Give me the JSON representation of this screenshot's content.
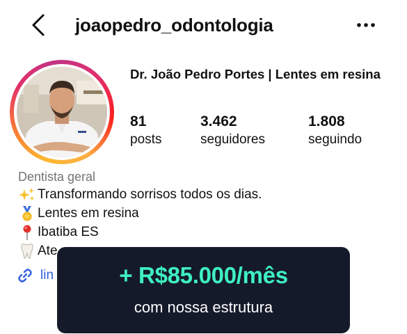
{
  "header": {
    "username": "joaopedro_odontologia",
    "back_icon": "chevron-left-icon",
    "more_icon": "more-horizontal-icon"
  },
  "profile": {
    "display_name": "Dr. João Pedro Portes | Lentes em resina",
    "stats": [
      {
        "value": "81",
        "label": "posts"
      },
      {
        "value": "3.462",
        "label": "seguidores"
      },
      {
        "value": "1.808",
        "label": "seguindo"
      }
    ],
    "category": "Dentista geral",
    "bio": [
      {
        "icon": "sparkles-icon",
        "text": "Transformando sorrisos todos os dias."
      },
      {
        "icon": "medal-icon",
        "text": "Lentes em resina"
      },
      {
        "icon": "pin-icon",
        "text": "Ibatiba ES"
      },
      {
        "icon": "tooth-icon",
        "text": "Ate"
      }
    ],
    "link_text": "lin"
  },
  "promo": {
    "amount": "+ R$85.000/mês",
    "subtitle": "com nossa estrutura"
  },
  "colors": {
    "promo_bg": "#151a2b",
    "promo_accent": "#3ef0c0",
    "link": "#2f5ee0",
    "muted": "#737373"
  }
}
